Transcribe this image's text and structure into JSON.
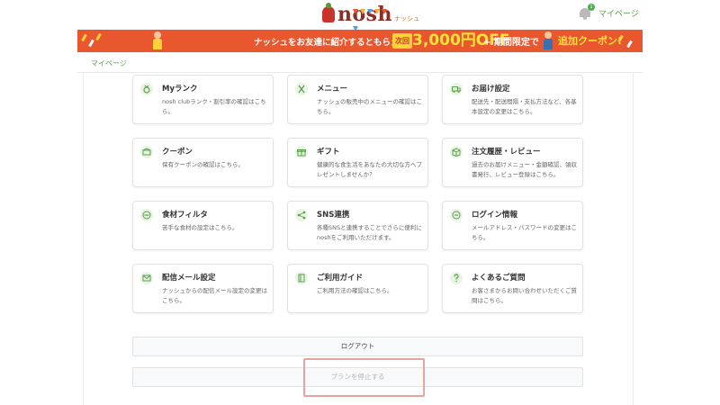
{
  "header": {
    "logo_text": "nosh",
    "logo_sub": "ナッシュ",
    "notification_badge": "1",
    "mypage_label": "マイページ"
  },
  "banner": {
    "lead_text": "ナッシュをお友達に紹介するともらえる！",
    "next_label": "次回",
    "amount_text": "3,000円OFF",
    "plus_text": "+ 期間限定で",
    "coupon_text": "追加クーポン!"
  },
  "breadcrumb": {
    "label": "マイページ"
  },
  "cards": [
    {
      "icon": "medal-icon",
      "title": "Myランク",
      "desc": "nosh clubランク・割引率の確認はこちら。"
    },
    {
      "icon": "fork-knife-icon",
      "title": "メニュー",
      "desc": "ナッシュの販売中のメニューの確認はこちら。"
    },
    {
      "icon": "truck-icon",
      "title": "お届け設定",
      "desc": "配送先・配送間隔・支払方法など、各基本設定の変更はこちら。"
    },
    {
      "icon": "coupon-icon",
      "title": "クーポン",
      "desc": "保有クーポンの確認はこちら。"
    },
    {
      "icon": "gift-icon",
      "title": "ギフト",
      "desc": "健康的な食生活をあなたの大切な方へプレゼントしませんか？"
    },
    {
      "icon": "box-icon",
      "title": "注文履歴・レビュー",
      "desc": "過去のお届けメニュー・金額確認、領収書発行、レビュー登録はこちら。"
    },
    {
      "icon": "filter-icon",
      "title": "食材フィルタ",
      "desc": "苦手な食材の設定はこちら。"
    },
    {
      "icon": "share-icon",
      "title": "SNS連携",
      "desc": "各種SNSと連携することでさらに便利にnoshをご利用いただけます。"
    },
    {
      "icon": "lock-icon",
      "title": "ログイン情報",
      "desc": "メールアドレス・パスワードの変更はこちら。"
    },
    {
      "icon": "mail-icon",
      "title": "配信メール設定",
      "desc": "ナッシュからの配信メール設定の変更はこちら。"
    },
    {
      "icon": "book-icon",
      "title": "ご利用ガイド",
      "desc": "ご利用方法の確認はこちら。"
    },
    {
      "icon": "question-icon",
      "title": "よくあるご質問",
      "desc": "お客さまからお問い合わせいただくご質問はこちら。"
    }
  ],
  "actions": {
    "logout_label": "ログアウト",
    "stop_plan_label": "プランを停止する"
  },
  "colors": {
    "accent_green": "#5aa04a",
    "banner_orange": "#e9572f",
    "highlight_pink": "#e8a3a0"
  }
}
